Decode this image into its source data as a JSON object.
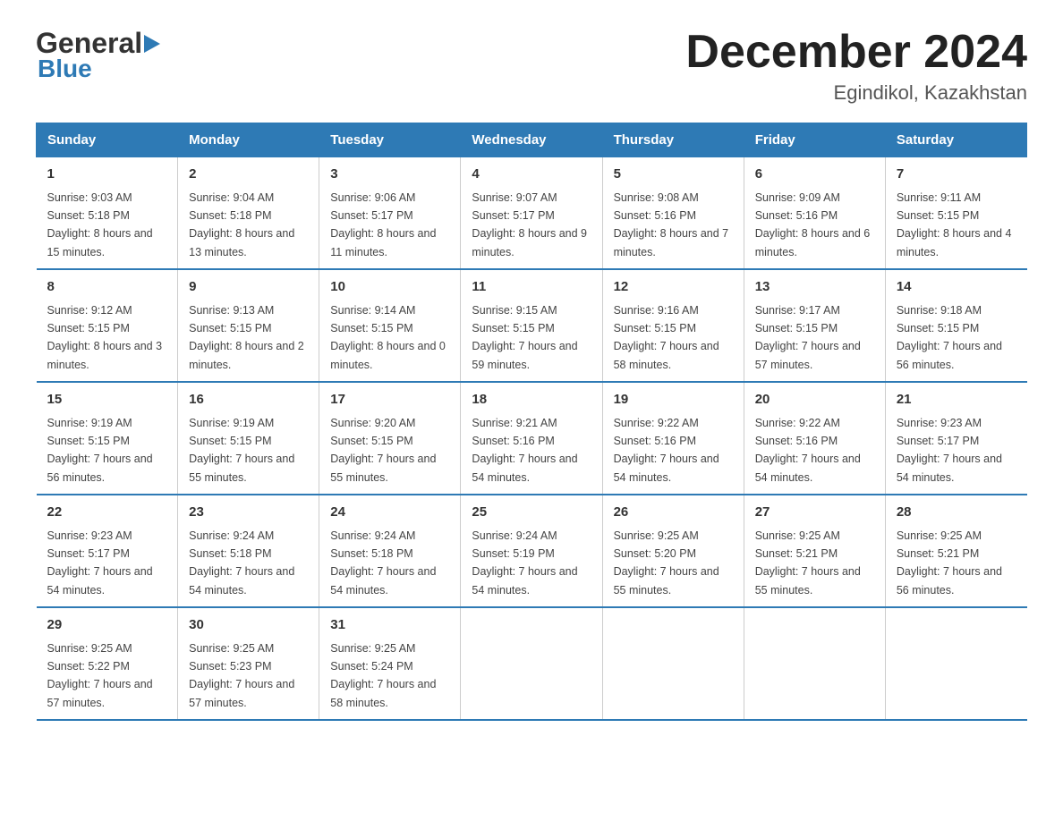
{
  "logo": {
    "line1": "General",
    "arrow": "▶",
    "line2": "Blue"
  },
  "title": "December 2024",
  "subtitle": "Egindikol, Kazakhstan",
  "weekdays": [
    "Sunday",
    "Monday",
    "Tuesday",
    "Wednesday",
    "Thursday",
    "Friday",
    "Saturday"
  ],
  "weeks": [
    [
      {
        "date": "1",
        "sunrise": "Sunrise: 9:03 AM",
        "sunset": "Sunset: 5:18 PM",
        "daylight": "Daylight: 8 hours and 15 minutes."
      },
      {
        "date": "2",
        "sunrise": "Sunrise: 9:04 AM",
        "sunset": "Sunset: 5:18 PM",
        "daylight": "Daylight: 8 hours and 13 minutes."
      },
      {
        "date": "3",
        "sunrise": "Sunrise: 9:06 AM",
        "sunset": "Sunset: 5:17 PM",
        "daylight": "Daylight: 8 hours and 11 minutes."
      },
      {
        "date": "4",
        "sunrise": "Sunrise: 9:07 AM",
        "sunset": "Sunset: 5:17 PM",
        "daylight": "Daylight: 8 hours and 9 minutes."
      },
      {
        "date": "5",
        "sunrise": "Sunrise: 9:08 AM",
        "sunset": "Sunset: 5:16 PM",
        "daylight": "Daylight: 8 hours and 7 minutes."
      },
      {
        "date": "6",
        "sunrise": "Sunrise: 9:09 AM",
        "sunset": "Sunset: 5:16 PM",
        "daylight": "Daylight: 8 hours and 6 minutes."
      },
      {
        "date": "7",
        "sunrise": "Sunrise: 9:11 AM",
        "sunset": "Sunset: 5:15 PM",
        "daylight": "Daylight: 8 hours and 4 minutes."
      }
    ],
    [
      {
        "date": "8",
        "sunrise": "Sunrise: 9:12 AM",
        "sunset": "Sunset: 5:15 PM",
        "daylight": "Daylight: 8 hours and 3 minutes."
      },
      {
        "date": "9",
        "sunrise": "Sunrise: 9:13 AM",
        "sunset": "Sunset: 5:15 PM",
        "daylight": "Daylight: 8 hours and 2 minutes."
      },
      {
        "date": "10",
        "sunrise": "Sunrise: 9:14 AM",
        "sunset": "Sunset: 5:15 PM",
        "daylight": "Daylight: 8 hours and 0 minutes."
      },
      {
        "date": "11",
        "sunrise": "Sunrise: 9:15 AM",
        "sunset": "Sunset: 5:15 PM",
        "daylight": "Daylight: 7 hours and 59 minutes."
      },
      {
        "date": "12",
        "sunrise": "Sunrise: 9:16 AM",
        "sunset": "Sunset: 5:15 PM",
        "daylight": "Daylight: 7 hours and 58 minutes."
      },
      {
        "date": "13",
        "sunrise": "Sunrise: 9:17 AM",
        "sunset": "Sunset: 5:15 PM",
        "daylight": "Daylight: 7 hours and 57 minutes."
      },
      {
        "date": "14",
        "sunrise": "Sunrise: 9:18 AM",
        "sunset": "Sunset: 5:15 PM",
        "daylight": "Daylight: 7 hours and 56 minutes."
      }
    ],
    [
      {
        "date": "15",
        "sunrise": "Sunrise: 9:19 AM",
        "sunset": "Sunset: 5:15 PM",
        "daylight": "Daylight: 7 hours and 56 minutes."
      },
      {
        "date": "16",
        "sunrise": "Sunrise: 9:19 AM",
        "sunset": "Sunset: 5:15 PM",
        "daylight": "Daylight: 7 hours and 55 minutes."
      },
      {
        "date": "17",
        "sunrise": "Sunrise: 9:20 AM",
        "sunset": "Sunset: 5:15 PM",
        "daylight": "Daylight: 7 hours and 55 minutes."
      },
      {
        "date": "18",
        "sunrise": "Sunrise: 9:21 AM",
        "sunset": "Sunset: 5:16 PM",
        "daylight": "Daylight: 7 hours and 54 minutes."
      },
      {
        "date": "19",
        "sunrise": "Sunrise: 9:22 AM",
        "sunset": "Sunset: 5:16 PM",
        "daylight": "Daylight: 7 hours and 54 minutes."
      },
      {
        "date": "20",
        "sunrise": "Sunrise: 9:22 AM",
        "sunset": "Sunset: 5:16 PM",
        "daylight": "Daylight: 7 hours and 54 minutes."
      },
      {
        "date": "21",
        "sunrise": "Sunrise: 9:23 AM",
        "sunset": "Sunset: 5:17 PM",
        "daylight": "Daylight: 7 hours and 54 minutes."
      }
    ],
    [
      {
        "date": "22",
        "sunrise": "Sunrise: 9:23 AM",
        "sunset": "Sunset: 5:17 PM",
        "daylight": "Daylight: 7 hours and 54 minutes."
      },
      {
        "date": "23",
        "sunrise": "Sunrise: 9:24 AM",
        "sunset": "Sunset: 5:18 PM",
        "daylight": "Daylight: 7 hours and 54 minutes."
      },
      {
        "date": "24",
        "sunrise": "Sunrise: 9:24 AM",
        "sunset": "Sunset: 5:18 PM",
        "daylight": "Daylight: 7 hours and 54 minutes."
      },
      {
        "date": "25",
        "sunrise": "Sunrise: 9:24 AM",
        "sunset": "Sunset: 5:19 PM",
        "daylight": "Daylight: 7 hours and 54 minutes."
      },
      {
        "date": "26",
        "sunrise": "Sunrise: 9:25 AM",
        "sunset": "Sunset: 5:20 PM",
        "daylight": "Daylight: 7 hours and 55 minutes."
      },
      {
        "date": "27",
        "sunrise": "Sunrise: 9:25 AM",
        "sunset": "Sunset: 5:21 PM",
        "daylight": "Daylight: 7 hours and 55 minutes."
      },
      {
        "date": "28",
        "sunrise": "Sunrise: 9:25 AM",
        "sunset": "Sunset: 5:21 PM",
        "daylight": "Daylight: 7 hours and 56 minutes."
      }
    ],
    [
      {
        "date": "29",
        "sunrise": "Sunrise: 9:25 AM",
        "sunset": "Sunset: 5:22 PM",
        "daylight": "Daylight: 7 hours and 57 minutes."
      },
      {
        "date": "30",
        "sunrise": "Sunrise: 9:25 AM",
        "sunset": "Sunset: 5:23 PM",
        "daylight": "Daylight: 7 hours and 57 minutes."
      },
      {
        "date": "31",
        "sunrise": "Sunrise: 9:25 AM",
        "sunset": "Sunset: 5:24 PM",
        "daylight": "Daylight: 7 hours and 58 minutes."
      },
      {
        "date": "",
        "sunrise": "",
        "sunset": "",
        "daylight": ""
      },
      {
        "date": "",
        "sunrise": "",
        "sunset": "",
        "daylight": ""
      },
      {
        "date": "",
        "sunrise": "",
        "sunset": "",
        "daylight": ""
      },
      {
        "date": "",
        "sunrise": "",
        "sunset": "",
        "daylight": ""
      }
    ]
  ]
}
